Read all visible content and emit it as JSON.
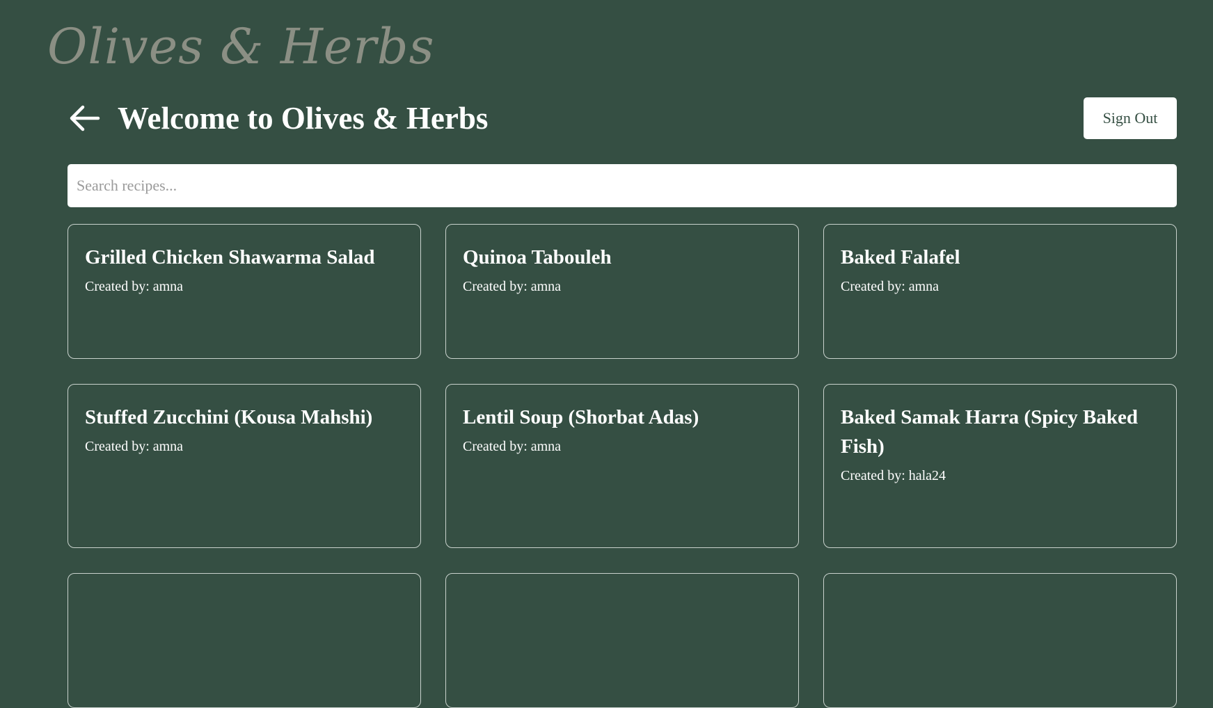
{
  "brand": {
    "logo_text": "Olives & Herbs"
  },
  "header": {
    "back_icon": "arrow-left-icon",
    "title": "Welcome to Olives & Herbs",
    "signout_label": "Sign Out"
  },
  "search": {
    "placeholder": "Search recipes...",
    "value": ""
  },
  "recipes": [
    {
      "title": "Grilled Chicken Shawarma Salad",
      "author": "Created by: amna"
    },
    {
      "title": "Quinoa Tabouleh",
      "author": "Created by: amna"
    },
    {
      "title": "Baked Falafel",
      "author": "Created by: amna"
    },
    {
      "title": "Stuffed Zucchini (Kousa Mahshi)",
      "author": "Created by: amna"
    },
    {
      "title": "Lentil Soup (Shorbat Adas)",
      "author": "Created by: amna"
    },
    {
      "title": "Baked Samak Harra (Spicy Baked Fish)",
      "author": "Created by: hala24"
    },
    {
      "title": "",
      "author": ""
    },
    {
      "title": "",
      "author": ""
    },
    {
      "title": "",
      "author": ""
    }
  ],
  "colors": {
    "background": "#354f43",
    "logo": "#8b8f84",
    "text": "#ffffff",
    "card_border": "#c9d2cd",
    "button_text": "#354f43"
  }
}
